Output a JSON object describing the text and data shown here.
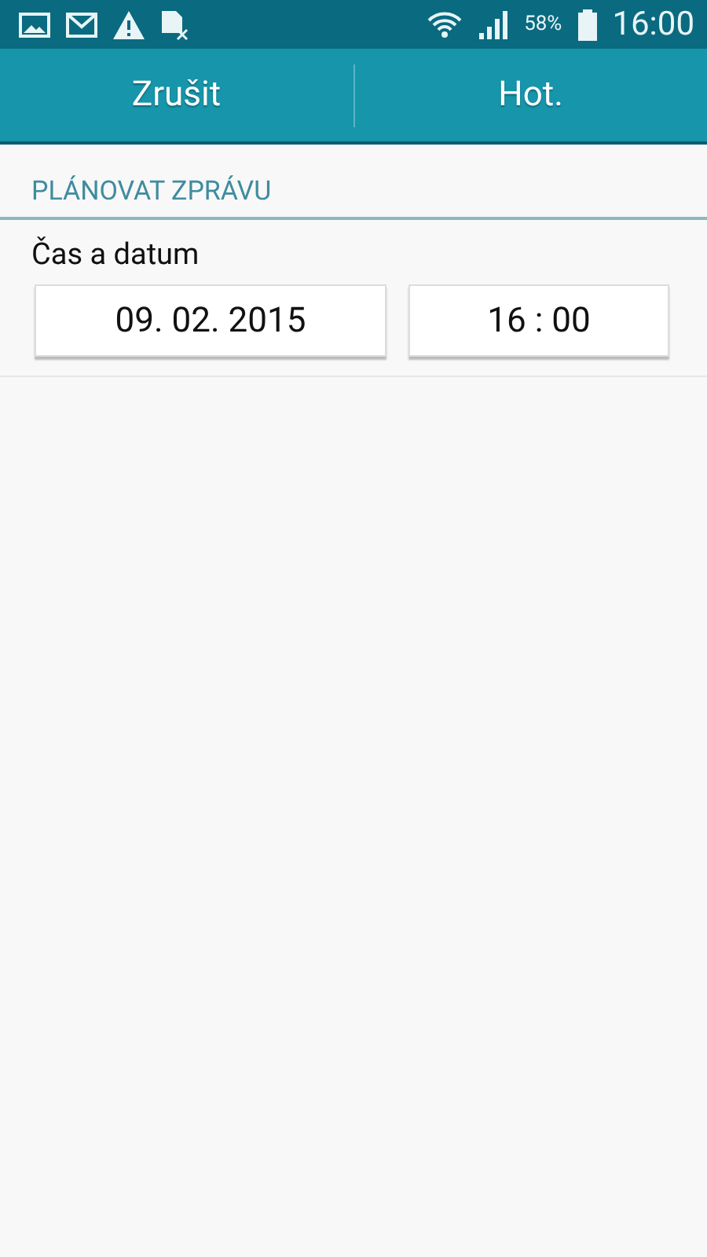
{
  "status_bar": {
    "battery": "58%",
    "time": "16:00"
  },
  "action_bar": {
    "buttons": [
      "Zrušit",
      "Hot."
    ]
  },
  "section": {
    "title": "PLÁNOVAT ZPRÁVU",
    "label": "Čas a datum",
    "date": "09. 02. 2015",
    "time": "16 : 00"
  }
}
